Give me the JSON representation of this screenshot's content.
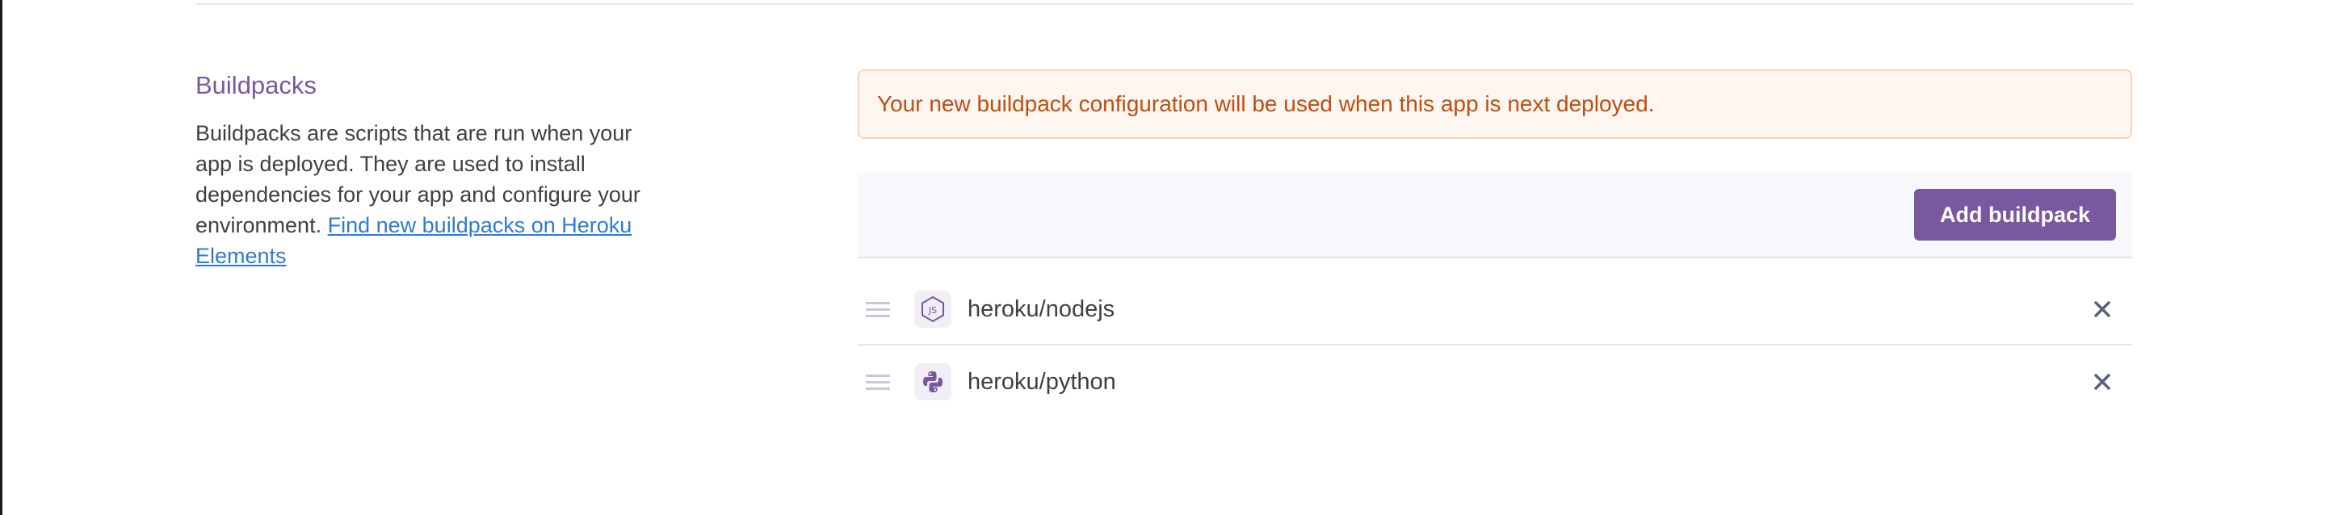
{
  "buildpacks_section": {
    "title": "Buildpacks",
    "description": "Buildpacks are scripts that are run when your app is deployed. They are used to install dependencies for your app and configure your environment.",
    "link_text": "Find new buildpacks on Heroku Elements"
  },
  "notice": {
    "text": "Your new buildpack configuration will be used when this app is next deployed."
  },
  "toolbar": {
    "add_label": "Add buildpack"
  },
  "buildpacks": [
    {
      "name": "heroku/nodejs",
      "icon": "nodejs-icon"
    },
    {
      "name": "heroku/python",
      "icon": "python-icon"
    }
  ],
  "colors": {
    "brand_purple": "#79589f",
    "notice_text": "#c04e0f",
    "notice_bg": "#fef7f1",
    "link": "#2f7bd4"
  }
}
